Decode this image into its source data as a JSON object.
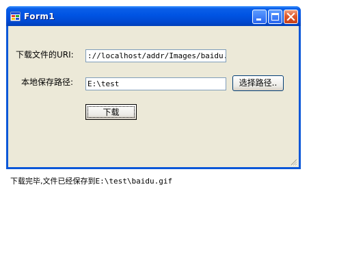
{
  "window": {
    "title": "Form1",
    "icon": "form-app-icon",
    "controls": [
      "minimize-icon",
      "maximize-icon",
      "close-icon"
    ]
  },
  "form": {
    "uri_label": "下载文件的URI:",
    "uri_value": "://localhost/addr/Images/baidu.gif",
    "path_label": "本地保存路径:",
    "path_value": "E:\\test",
    "browse_button": "选择路径..",
    "download_button": "下载"
  },
  "status": {
    "prefix": "下载完毕,文件已经保存到",
    "path": "E:\\test\\baidu.gif"
  },
  "colors": {
    "titlebar": "#0054e3",
    "client_bg": "#ece9d8",
    "close_button": "#e0582a"
  }
}
